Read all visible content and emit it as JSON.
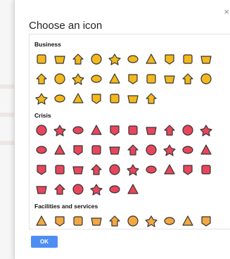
{
  "dialog": {
    "title": "Choose an icon",
    "ok_label": "OK"
  },
  "colors": {
    "business": "#f3b81b",
    "crisis": "#e8465c",
    "facilities": "#f2a743",
    "outline": "#333333"
  },
  "categories": [
    {
      "name": "Business",
      "color_key": "business",
      "icons": [
        "restaurant-icon",
        "coffee-cup-icon",
        "cocktail-icon",
        "thumbs-up-icon",
        "hand-icon",
        "briefcase-icon",
        "film-icon",
        "thumb-icon",
        "shopping-cart-icon",
        "ticket-icon",
        "heart-icon",
        "flower-icon",
        "gift-icon",
        "music-note-icon",
        "home-icon",
        "monitor-icon",
        "wrench-icon",
        "gas-station-icon",
        "house-icon",
        "scissors-icon",
        "dollar-icon",
        "euro-icon",
        "yen-icon",
        "bed-icon",
        "camera-icon",
        "mail-icon",
        "video-camera-icon"
      ]
    },
    {
      "name": "Crisis",
      "color_key": "crisis",
      "icons": [
        "faucet-icon",
        "paw-icon",
        "biohazard-icon",
        "warning-icon",
        "fire-icon",
        "megaphone-icon",
        "gun-icon",
        "storm-icon",
        "drop-icon",
        "skull-icon",
        "heart-pulse-icon",
        "lightning-icon",
        "target-icon",
        "explosion-icon",
        "shipwreck-icon",
        "flood-icon",
        "cyclone-icon",
        "hurricane-icon",
        "virus-icon",
        "bug-icon",
        "plane-crash-icon",
        "volcano-icon",
        "person-icon",
        "tsunami-icon",
        "radiation-icon",
        "gas-mask-icon",
        "helmet-icon",
        "car-crash-icon",
        "thermometer-icon",
        "tornado-icon",
        "tornado-small-icon",
        "wave-icon",
        "snow-icon",
        "truck-icon",
        "wind-icon",
        "landslide-icon"
      ]
    },
    {
      "name": "Facilities and services",
      "color_key": "facilities",
      "icons": [
        "recycle-icon",
        "flag-icon",
        "house-service-icon",
        "help-icon",
        "wrench-service-icon",
        "info-icon",
        "plus-icon",
        "parking-icon",
        "phone-icon",
        "star-icon"
      ]
    }
  ]
}
